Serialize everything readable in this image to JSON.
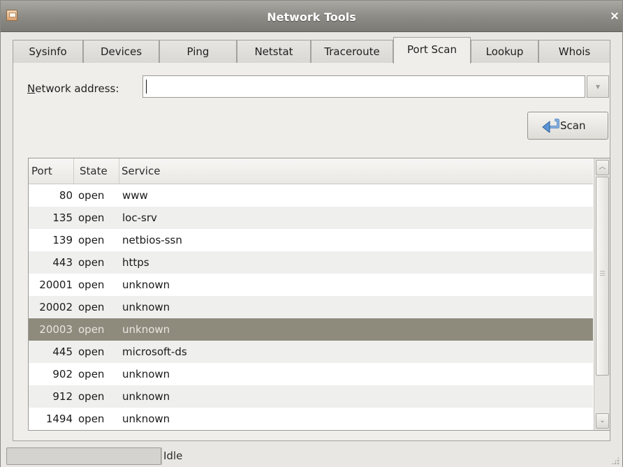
{
  "window": {
    "title": "Network Tools",
    "close_glyph": "×",
    "app_icon": "network-tools-icon"
  },
  "tabs": [
    {
      "label": "Sysinfo"
    },
    {
      "label": "Devices"
    },
    {
      "label": "Ping"
    },
    {
      "label": "Netstat"
    },
    {
      "label": "Traceroute"
    },
    {
      "label": "Port Scan",
      "active": true
    },
    {
      "label": "Lookup"
    },
    {
      "label": "Whois"
    }
  ],
  "port_scan": {
    "address_label_mnemonic": "N",
    "address_label_rest": "etwork address:",
    "address_value": "",
    "address_dropdown_glyph": "▾",
    "scan_button_label": "Scan",
    "scan_icon": "return-arrow-icon"
  },
  "table": {
    "columns": [
      "Port",
      "State",
      "Service"
    ],
    "rows": [
      {
        "port": "80",
        "state": "open",
        "service": "www"
      },
      {
        "port": "135",
        "state": "open",
        "service": "loc-srv"
      },
      {
        "port": "139",
        "state": "open",
        "service": "netbios-ssn"
      },
      {
        "port": "443",
        "state": "open",
        "service": "https"
      },
      {
        "port": "20001",
        "state": "open",
        "service": "unknown"
      },
      {
        "port": "20002",
        "state": "open",
        "service": "unknown"
      },
      {
        "port": "20003",
        "state": "open",
        "service": "unknown",
        "selected": true
      },
      {
        "port": "445",
        "state": "open",
        "service": "microsoft-ds"
      },
      {
        "port": "902",
        "state": "open",
        "service": "unknown"
      },
      {
        "port": "912",
        "state": "open",
        "service": "unknown"
      },
      {
        "port": "1494",
        "state": "open",
        "service": "unknown"
      }
    ],
    "scroll_up_glyph": "︿",
    "scroll_down_glyph": "⌄"
  },
  "status": {
    "progress_fraction": 0,
    "text": "Idle"
  },
  "colors": {
    "selection": "#8e8b7d",
    "titlebar": "#8b8a84",
    "alt_row": "#efefee"
  }
}
